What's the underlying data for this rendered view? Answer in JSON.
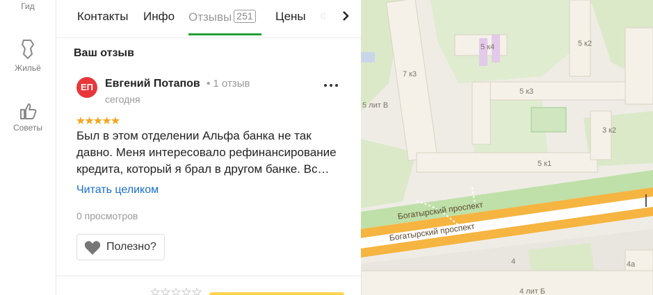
{
  "rail": {
    "items": [
      {
        "label": "Гид"
      },
      {
        "label": "Жильё"
      },
      {
        "label": "Советы"
      }
    ]
  },
  "tabs": [
    {
      "label": "Контакты"
    },
    {
      "label": "Инфо"
    },
    {
      "label": "Отзывы",
      "count": "251"
    },
    {
      "label": "Цены"
    },
    {
      "label": "Фо"
    }
  ],
  "section": {
    "title": "Ваш отзыв"
  },
  "review": {
    "avatar_initials": "ЕП",
    "author": "Евгений Потапов",
    "author_meta": "• 1 отзыв",
    "date": "сегодня",
    "rating": 5,
    "text": "Был в этом отделении Альфа банка не так давно. Меня интересовало рефинансирование кредита, который я брал в другом банке. Вс…",
    "read_more": "Читать целиком",
    "views": "0 просмотров",
    "helpful": "Полезно?"
  },
  "map": {
    "labels": [
      "5 к4",
      "5 к2",
      "7 к3",
      "5 к3",
      "5 лит В",
      "3 к2",
      "5 к1",
      "4",
      "4а",
      "4 лит Б"
    ],
    "streets": [
      "Богатырский проспект",
      "Богатырский проспект"
    ]
  },
  "colors": {
    "accent": "#23a036",
    "link": "#1a6dcc",
    "avatar": "#e8373b",
    "star": "#f5a623"
  }
}
